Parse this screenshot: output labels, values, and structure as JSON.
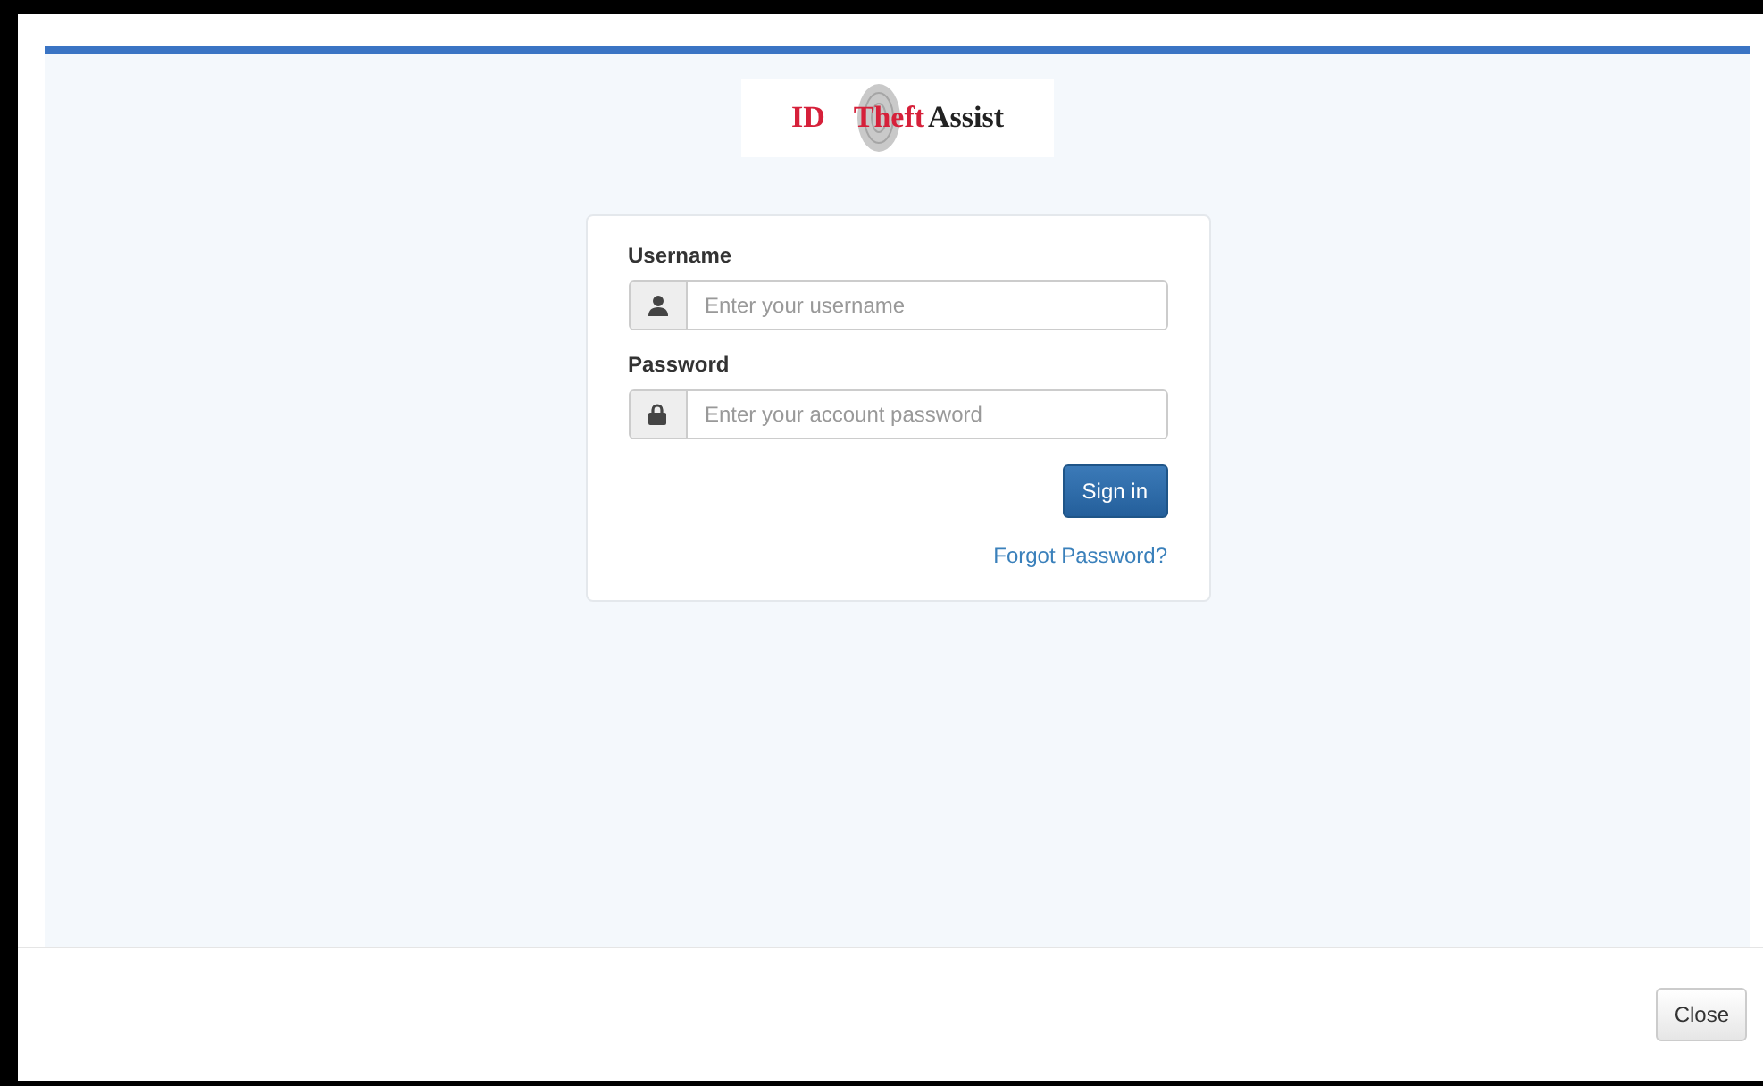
{
  "logo": {
    "parts": [
      {
        "text": "ID",
        "color": "#d6203a"
      },
      {
        "text": "Theft",
        "color": "#d6203a"
      },
      {
        "text": "Assist",
        "color": "#222222"
      }
    ]
  },
  "login": {
    "fields": [
      {
        "label": "Username",
        "placeholder": "Enter your username",
        "kind": "user"
      },
      {
        "label": "Password",
        "placeholder": "Enter your account password",
        "kind": "lock"
      }
    ],
    "submit": "Sign in",
    "forgot_link": "Forgot Password?"
  },
  "footer": {
    "close_button": "Close"
  }
}
